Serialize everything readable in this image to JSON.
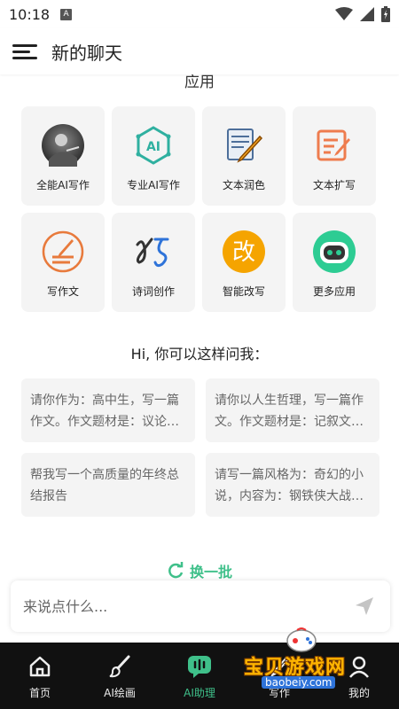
{
  "status": {
    "time": "10:18",
    "notification_icon": "A"
  },
  "header": {
    "title": "新的聊天"
  },
  "apps_section": {
    "title": "应用"
  },
  "apps": [
    {
      "label": "全能AI写作",
      "icon": "ai-portrait-icon"
    },
    {
      "label": "专业AI写作",
      "icon": "ai-hexagon-icon"
    },
    {
      "label": "文本润色",
      "icon": "paper-pencil-icon"
    },
    {
      "label": "文本扩写",
      "icon": "edit-doc-icon"
    },
    {
      "label": "写作文",
      "icon": "write-essay-icon"
    },
    {
      "label": "诗词创作",
      "icon": "poetry-icon"
    },
    {
      "label": "智能改写",
      "icon": "rewrite-icon",
      "glyph": "改"
    },
    {
      "label": "更多应用",
      "icon": "robot-icon"
    }
  ],
  "prompts": {
    "heading": "Hi, 你可以这样问我：",
    "items": [
      "请你作为：高中生，写一篇作文。作文题材是：议论文，作文要求：",
      "请你以人生哲理，写一篇作文。作文题材是：记叙文，作文要求：",
      "帮我写一个高质量的年终总结报告",
      "请写一篇风格为：奇幻的小说，内容为：钢铁侠大战灭霸"
    ]
  },
  "refresh_label": "换一批",
  "input": {
    "placeholder": "来说点什么..."
  },
  "tabs": [
    {
      "label": "首页",
      "icon": "home-icon"
    },
    {
      "label": "AI绘画",
      "icon": "brush-icon"
    },
    {
      "label": "AI助理",
      "icon": "chat-bubble-icon",
      "active": true
    },
    {
      "label": "写作",
      "icon": "write-icon"
    },
    {
      "label": "我的",
      "icon": "profile-icon"
    }
  ],
  "watermark": {
    "text": "宝贝游戏网",
    "url": "baobeiy.com"
  },
  "colors": {
    "accent": "#3fc08a",
    "tab_bar": "#111111",
    "card_bg": "#f4f4f4",
    "watermark": "#ffb400"
  }
}
